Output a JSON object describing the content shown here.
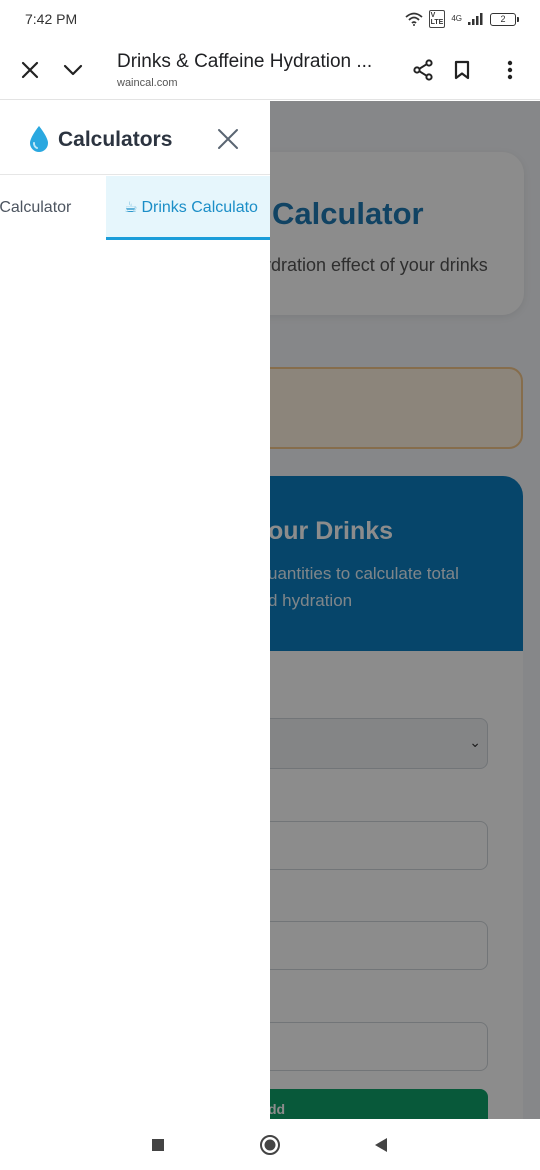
{
  "status_bar": {
    "time": "7:42 PM",
    "network": "4G",
    "battery": "2"
  },
  "browser": {
    "page_title": "Drinks & Caffeine Hydration ...",
    "url": "waincal.com"
  },
  "drawer": {
    "title": "Calculators",
    "tabs": [
      {
        "label": "e Calculator",
        "active": false
      },
      {
        "icon": "☕",
        "label": "Drinks Calculato",
        "active": true
      }
    ]
  },
  "background_page": {
    "hero_title": "Calculator",
    "hero_subtitle": "rdration effect of your drinks",
    "section_title": "our Drinks",
    "section_desc_line1": "uantities to calculate total",
    "section_desc_line2": "d hydration",
    "add_button": "dd"
  },
  "colors": {
    "accent": "#1b9dd9",
    "hero_title": "#1f7bb5",
    "drinks_card": "#0b7fc1",
    "add_button": "#10a36a"
  }
}
